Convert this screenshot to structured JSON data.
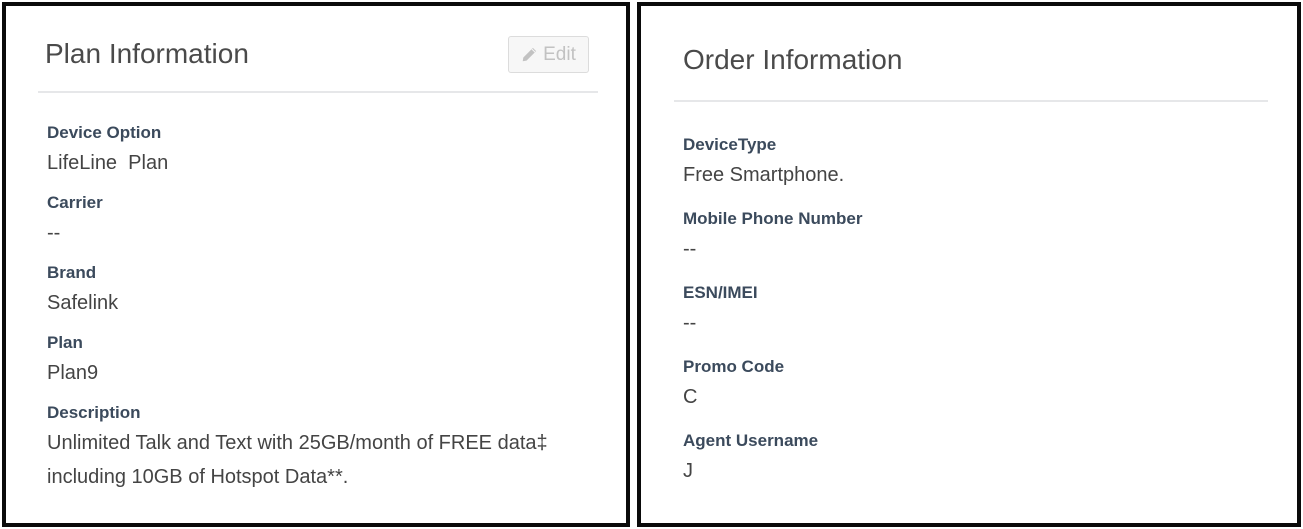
{
  "plan_panel": {
    "title": "Plan Information",
    "edit_label": "Edit",
    "fields": [
      {
        "label": "Device Option",
        "value": "LifeLine  Plan"
      },
      {
        "label": "Carrier",
        "value": "--"
      },
      {
        "label": "Brand",
        "value": "Safelink"
      },
      {
        "label": "Plan",
        "value": "Plan9"
      },
      {
        "label": "Description",
        "value": "Unlimited Talk and Text with 25GB/month of FREE data‡ including 10GB of Hotspot Data**."
      }
    ]
  },
  "order_panel": {
    "title": "Order Information",
    "fields": [
      {
        "label": "DeviceType",
        "value": "Free Smartphone."
      },
      {
        "label": "Mobile Phone Number",
        "value": "--"
      },
      {
        "label": "ESN/IMEI",
        "value": "--"
      },
      {
        "label": "Promo Code",
        "value": "C"
      },
      {
        "label": "Agent Username",
        "value": "J"
      }
    ]
  },
  "icons": {
    "edit": "pencil-icon"
  },
  "colors": {
    "label": "#3b4a5c",
    "value": "#444444",
    "title": "#4a4a4a",
    "divider": "#e6e7e9",
    "panel_border": "#0a0a0a",
    "disabled_button_text": "#c2c2c2"
  }
}
